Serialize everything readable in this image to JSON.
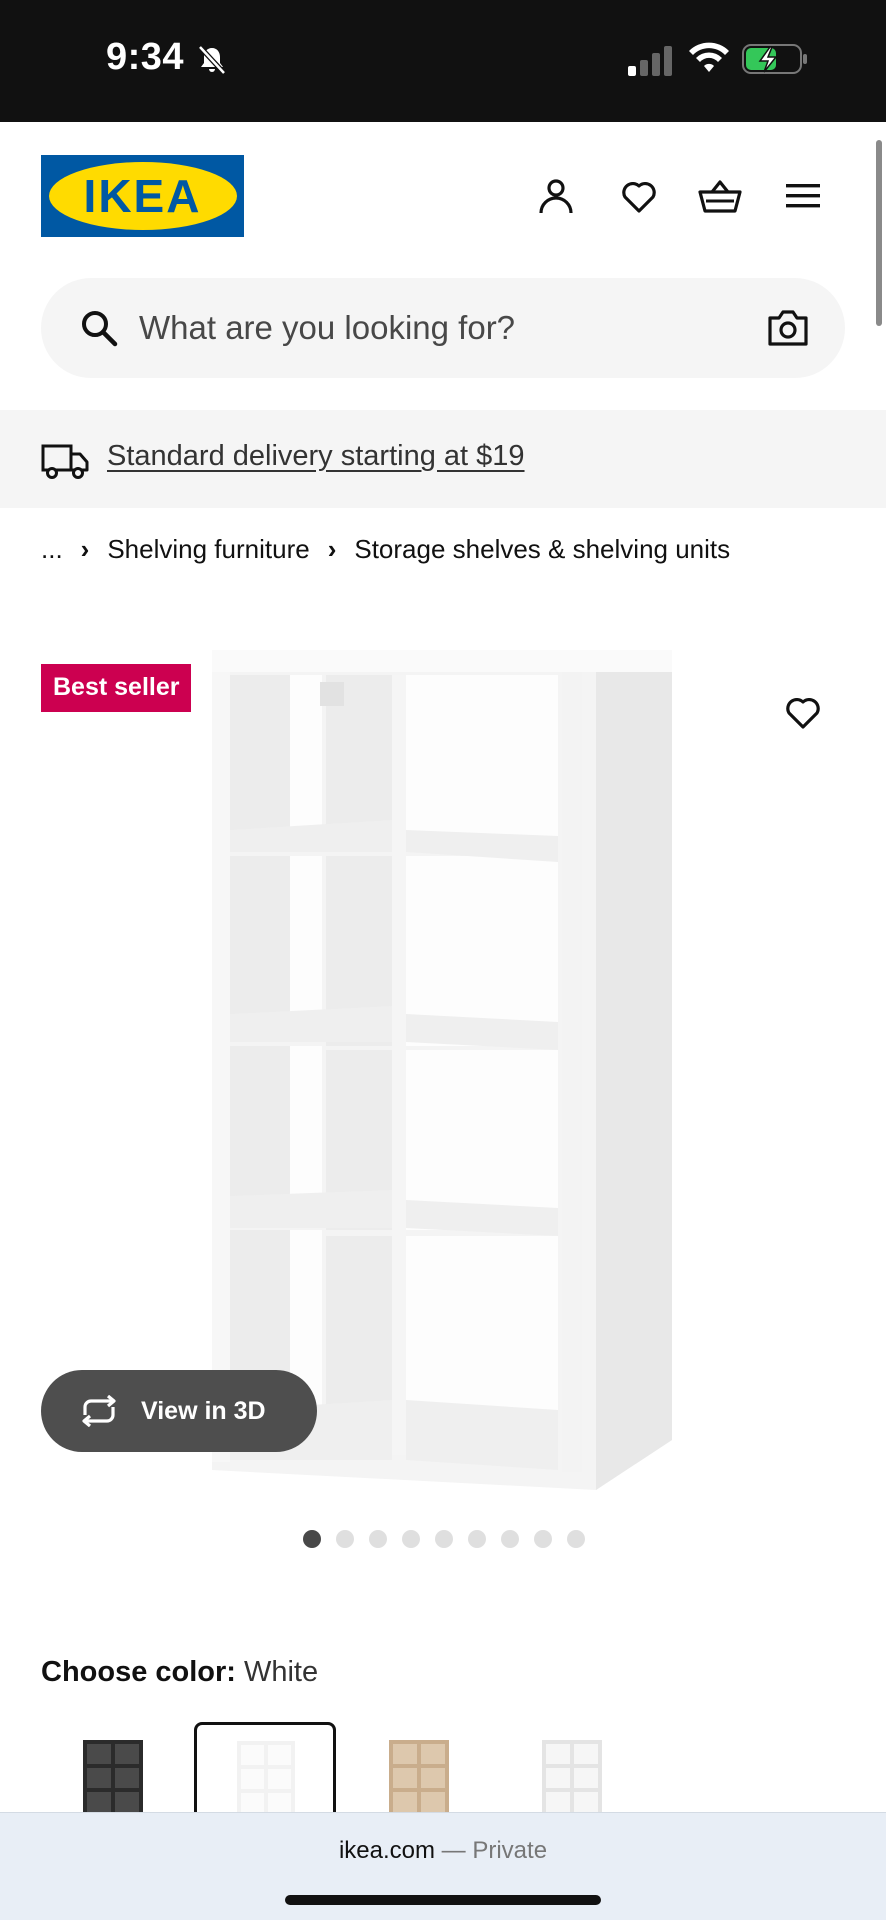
{
  "status_bar": {
    "time": "9:34",
    "icons": [
      "bell-slash-icon",
      "cellular-signal-icon",
      "wifi-icon",
      "battery-charging-icon"
    ]
  },
  "header": {
    "logo_text": "IKEA",
    "brand_colors": {
      "blue": "#0058a3",
      "yellow": "#ffdb00"
    },
    "icons": [
      "profile-icon",
      "heart-icon",
      "basket-icon",
      "hamburger-menu-icon"
    ]
  },
  "search": {
    "placeholder": "What are you looking for?"
  },
  "delivery": {
    "text": "Standard delivery starting at $19"
  },
  "breadcrumb": {
    "items": [
      "...",
      "Shelving furniture",
      "Storage shelves & shelving units"
    ]
  },
  "product": {
    "badge": "Best seller",
    "badge_color": "#cc0050",
    "view_3d_label": "View in 3D",
    "carousel": {
      "total": 9,
      "active": 1
    }
  },
  "color_chooser": {
    "label": "Choose color:",
    "selected": "White",
    "swatches": [
      "black-brown",
      "white",
      "white-stained-oak",
      "white-gray"
    ]
  },
  "browser": {
    "domain": "ikea.com",
    "mode": "— Private"
  }
}
